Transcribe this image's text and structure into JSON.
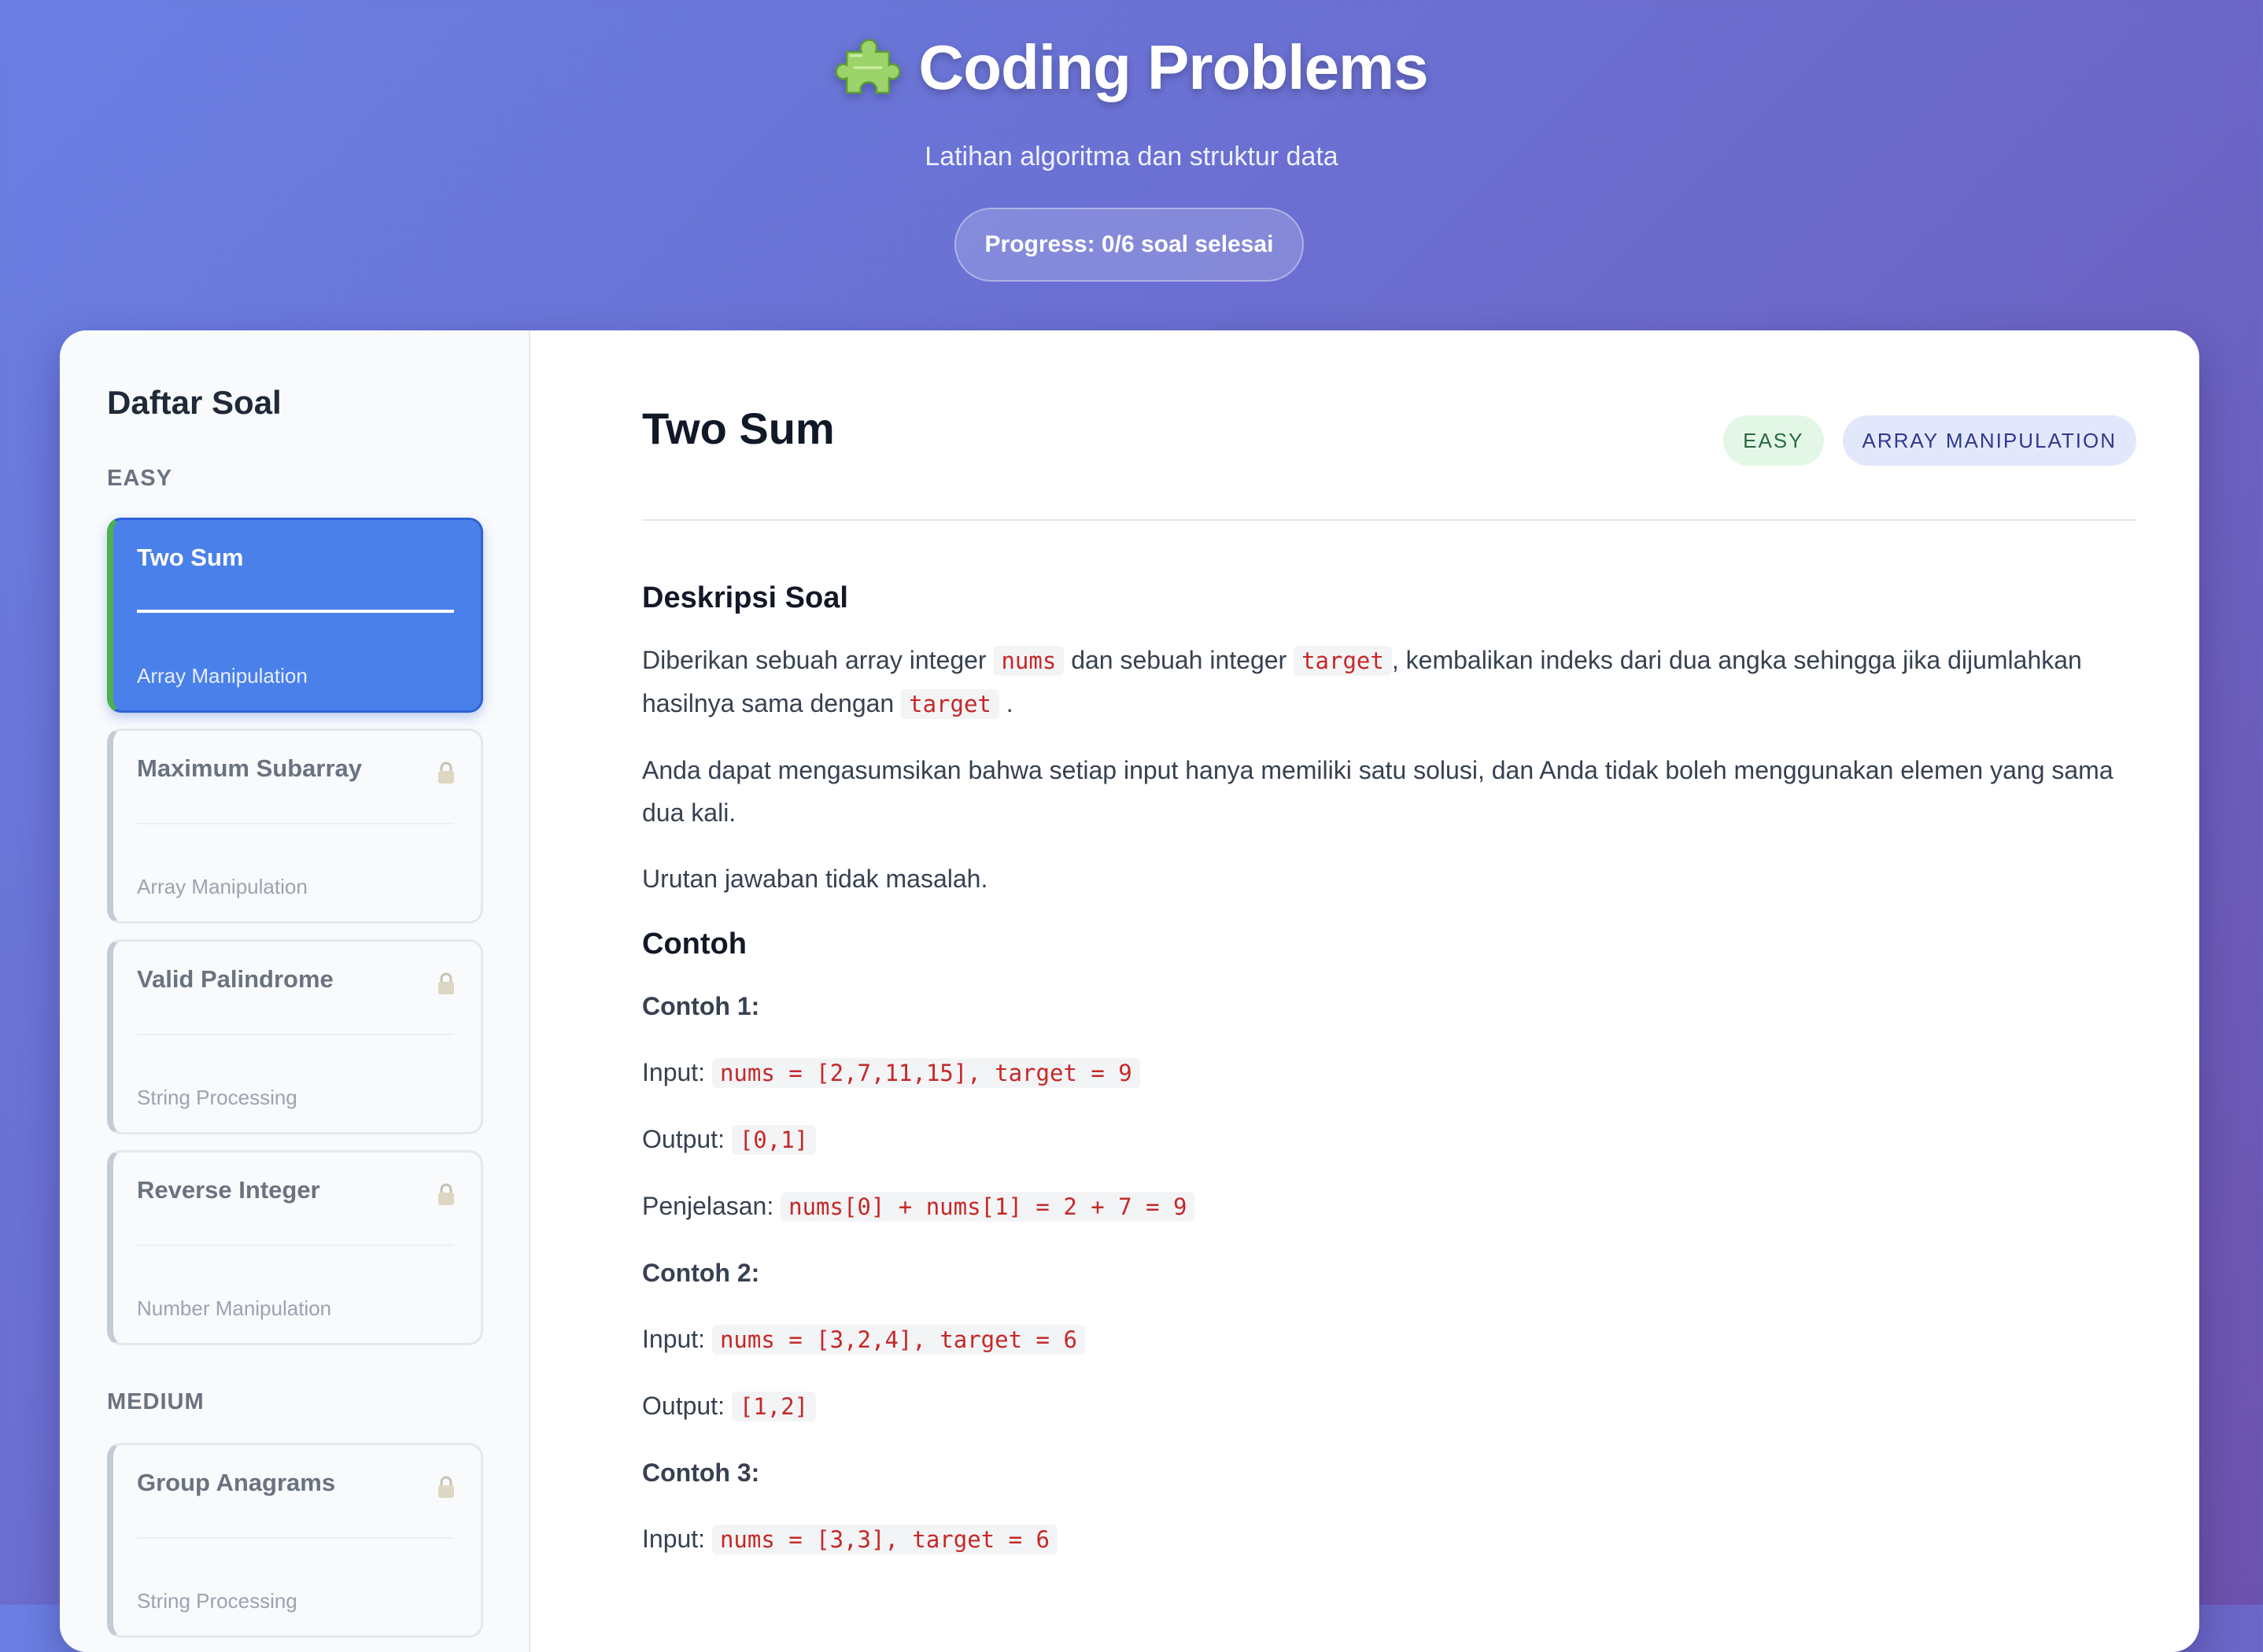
{
  "header": {
    "title": "Coding Problems",
    "subtitle": "Latihan algoritma dan struktur data",
    "progress": "Progress: 0/6 soal selesai"
  },
  "sidebar": {
    "title": "Daftar Soal",
    "groups": [
      {
        "label": "EASY",
        "items": [
          {
            "name": "Two Sum",
            "category": "Array Manipulation",
            "active": true,
            "locked": false
          },
          {
            "name": "Maximum Subarray",
            "category": "Array Manipulation",
            "active": false,
            "locked": true
          },
          {
            "name": "Valid Palindrome",
            "category": "String Processing",
            "active": false,
            "locked": true
          },
          {
            "name": "Reverse Integer",
            "category": "Number Manipulation",
            "active": false,
            "locked": true
          }
        ]
      },
      {
        "label": "MEDIUM",
        "items": [
          {
            "name": "Group Anagrams",
            "category": "String Processing",
            "active": false,
            "locked": true
          }
        ]
      }
    ]
  },
  "problem": {
    "title": "Two Sum",
    "difficulty_badge": "EASY",
    "category_badge": "ARRAY MANIPULATION",
    "description_heading": "Deskripsi Soal",
    "desc_p1": {
      "t1": "Diberikan sebuah array integer",
      "c1": "nums",
      "t2": "dan sebuah integer",
      "c2": "target",
      "t3": ", kembalikan indeks dari dua angka sehingga jika dijumlahkan hasilnya sama dengan",
      "c3": "target",
      "t4": "."
    },
    "desc_p2": "Anda dapat mengasumsikan bahwa setiap input hanya memiliki satu solusi, dan Anda tidak boleh menggunakan elemen yang sama dua kali.",
    "desc_p3": "Urutan jawaban tidak masalah.",
    "examples_heading": "Contoh",
    "examples": [
      {
        "label": "Contoh 1:",
        "input_label": "Input:",
        "input": "nums = [2,7,11,15], target = 9",
        "output_label": "Output:",
        "output": "[0,1]",
        "explanation_label": "Penjelasan:",
        "explanation": "nums[0] + nums[1] = 2 + 7 = 9"
      },
      {
        "label": "Contoh 2:",
        "input_label": "Input:",
        "input": "nums = [3,2,4], target = 6",
        "output_label": "Output:",
        "output": "[1,2]"
      },
      {
        "label": "Contoh 3:",
        "input_label": "Input:",
        "input": "nums = [3,3], target = 6"
      }
    ]
  },
  "colors": {
    "accent_active": "#4a80ea",
    "easy_green": "#4caf50",
    "code_red": "#c62828"
  },
  "icons": {
    "title_icon": "puzzle-piece-icon",
    "lock_icon": "lock-icon"
  }
}
